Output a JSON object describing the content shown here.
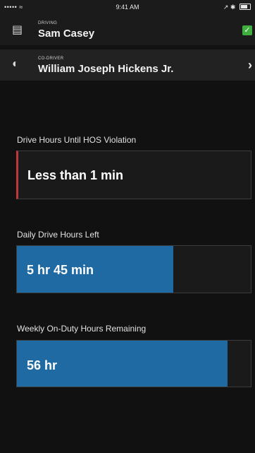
{
  "status_bar": {
    "signal": "•••••",
    "wifi": "≈",
    "time": "9:41 AM",
    "right": "↗ ✱"
  },
  "driving": {
    "label": "DRIVING",
    "name": "Sam Casey",
    "icon": "list-icon",
    "status_icon": "check-icon",
    "status_color": "#3fae3f"
  },
  "codriver": {
    "label": "CO-DRIVER",
    "name": "William Joseph Hickens Jr.",
    "icon": "half-moon-icon",
    "action_icon": "chevron-right-icon"
  },
  "sections": {
    "hos": {
      "label": "Drive Hours Until HOS Violation",
      "value": "Less than 1 min",
      "accent_color": "#c2363c"
    },
    "daily": {
      "label": "Daily Drive Hours Left",
      "value": "5 hr 45 min",
      "fill_fraction": 0.67,
      "fill_color": "#1f6aa3"
    },
    "weekly": {
      "label": "Weekly On-Duty Hours Remaining",
      "value": "56 hr",
      "fill_fraction": 0.9,
      "fill_color": "#1f6aa3"
    }
  }
}
